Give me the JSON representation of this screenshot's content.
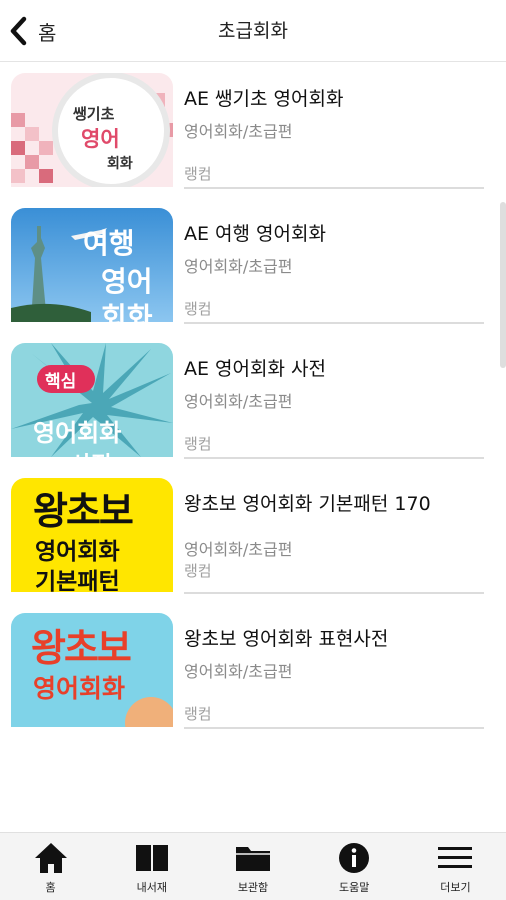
{
  "header": {
    "back_label": "홈",
    "title": "초급회화"
  },
  "items": [
    {
      "title": "AE 쌩기초 영어회화",
      "subtitle": "영어회화/초급편",
      "publisher": "랭컴",
      "thumb_lines": [
        "쌩기초",
        "영어",
        "회화"
      ]
    },
    {
      "title": "AE 여행 영어회화",
      "subtitle": "영어회화/초급편",
      "publisher": "랭컴",
      "thumb_lines": [
        "여행",
        "영어",
        "회화"
      ]
    },
    {
      "title": "AE 영어회화 사전",
      "subtitle": "영어회화/초급편",
      "publisher": "랭컴",
      "thumb_lines": [
        "핵심",
        "영어회화",
        "사전"
      ]
    },
    {
      "title": "왕초보 영어회화 기본패턴 170",
      "subtitle": "영어회화/초급편",
      "publisher": "랭컴",
      "thumb_lines": [
        "왕초보",
        "영어회화",
        "기본패턴"
      ]
    },
    {
      "title": "왕초보 영어회화 표현사전",
      "subtitle": "영어회화/초급편",
      "publisher": "랭컴",
      "thumb_lines": [
        "왕초보",
        "영어회화"
      ]
    }
  ],
  "tabs": [
    {
      "label": "홈",
      "icon": "home-icon"
    },
    {
      "label": "내서재",
      "icon": "book-icon"
    },
    {
      "label": "보관함",
      "icon": "folder-icon"
    },
    {
      "label": "도움말",
      "icon": "info-icon"
    },
    {
      "label": "더보기",
      "icon": "menu-icon"
    }
  ],
  "colors": {
    "accent": "#000000",
    "divider": "#dcdcdc",
    "muted_text": "#8a8a8a"
  }
}
